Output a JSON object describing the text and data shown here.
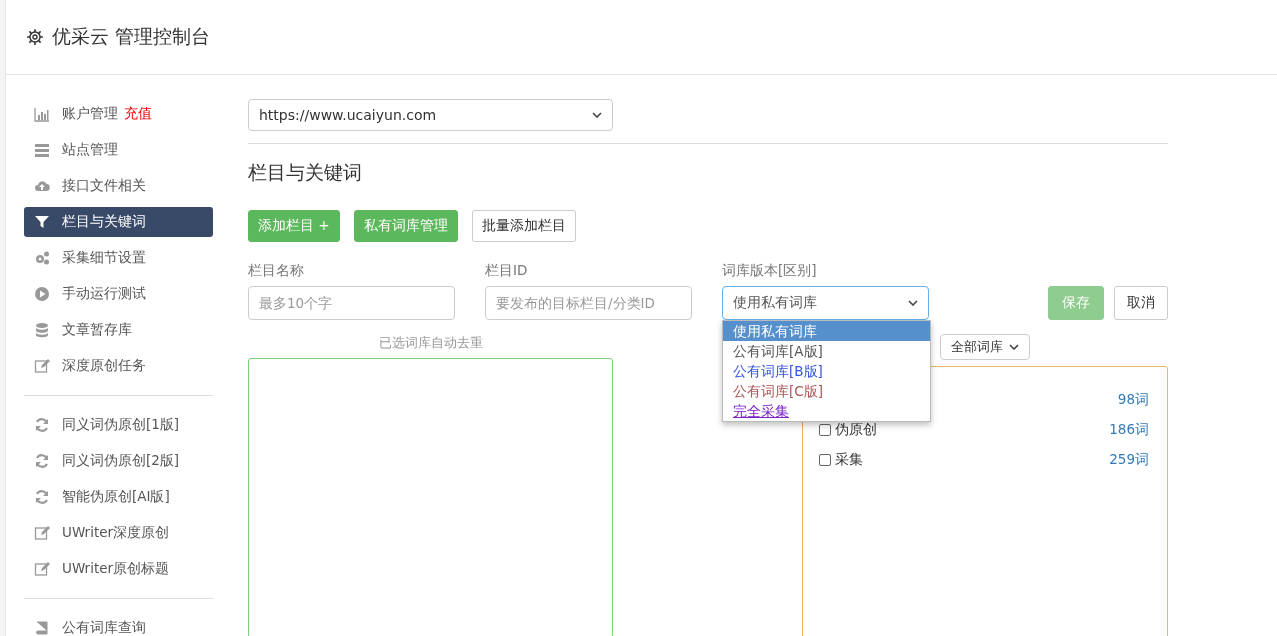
{
  "header": {
    "title": "优采云 管理控制台"
  },
  "sidebar": {
    "groups": [
      [
        {
          "label": "账户管理",
          "badge": "充值",
          "selected": false
        },
        {
          "label": "站点管理",
          "selected": false
        },
        {
          "label": "接口文件相关",
          "selected": false
        },
        {
          "label": "栏目与关键词",
          "selected": true
        },
        {
          "label": "采集细节设置",
          "selected": false
        },
        {
          "label": "手动运行测试",
          "selected": false
        },
        {
          "label": "文章暂存库",
          "selected": false
        },
        {
          "label": "深度原创任务",
          "selected": false
        }
      ],
      [
        {
          "label": "同义词伪原创[1版]",
          "selected": false
        },
        {
          "label": "同义词伪原创[2版]",
          "selected": false
        },
        {
          "label": "智能伪原创[AI版]",
          "selected": false
        },
        {
          "label": "UWriter深度原创",
          "selected": false
        },
        {
          "label": "UWriter原创标题",
          "selected": false
        }
      ],
      [
        {
          "label": "公有词库查询",
          "selected": false
        }
      ]
    ]
  },
  "site_select": {
    "value": "https://www.ucaiyun.com"
  },
  "section_title": "栏目与关键词",
  "toolbar": [
    {
      "label": "添加栏目 +",
      "kind": "primary"
    },
    {
      "label": "私有词库管理",
      "kind": "primary"
    },
    {
      "label": "批量添加栏目",
      "kind": "default"
    }
  ],
  "form": {
    "name_field": {
      "label": "栏目名称",
      "placeholder": "最多10个字"
    },
    "id_field": {
      "label": "栏目ID",
      "placeholder": "要发布的目标栏目/分类ID"
    },
    "version_field": {
      "label": "词库版本[区别]",
      "value": "使用私有词库",
      "expanded": true,
      "options": [
        {
          "label": "使用私有词库",
          "selected": true
        },
        {
          "label": "公有词库[A版]",
          "selected": false,
          "color": "#555555"
        },
        {
          "label": "公有词库[B版]",
          "selected": false,
          "color": "#3355dd"
        },
        {
          "label": "公有词库[C版]",
          "selected": false,
          "color": "#aa5555"
        },
        {
          "label": "完全采集",
          "selected": false,
          "color": "#7a22cc"
        }
      ]
    },
    "save_button": "保存",
    "cancel_button": "取消"
  },
  "dedupe_note": "已选词库自动去重",
  "library_filter": {
    "value": "全部词库"
  },
  "libraries": [
    {
      "count": "98词"
    },
    {
      "label": "伪原创",
      "count": "186词",
      "checked": false
    },
    {
      "label": "采集",
      "count": "259词",
      "checked": false
    }
  ]
}
